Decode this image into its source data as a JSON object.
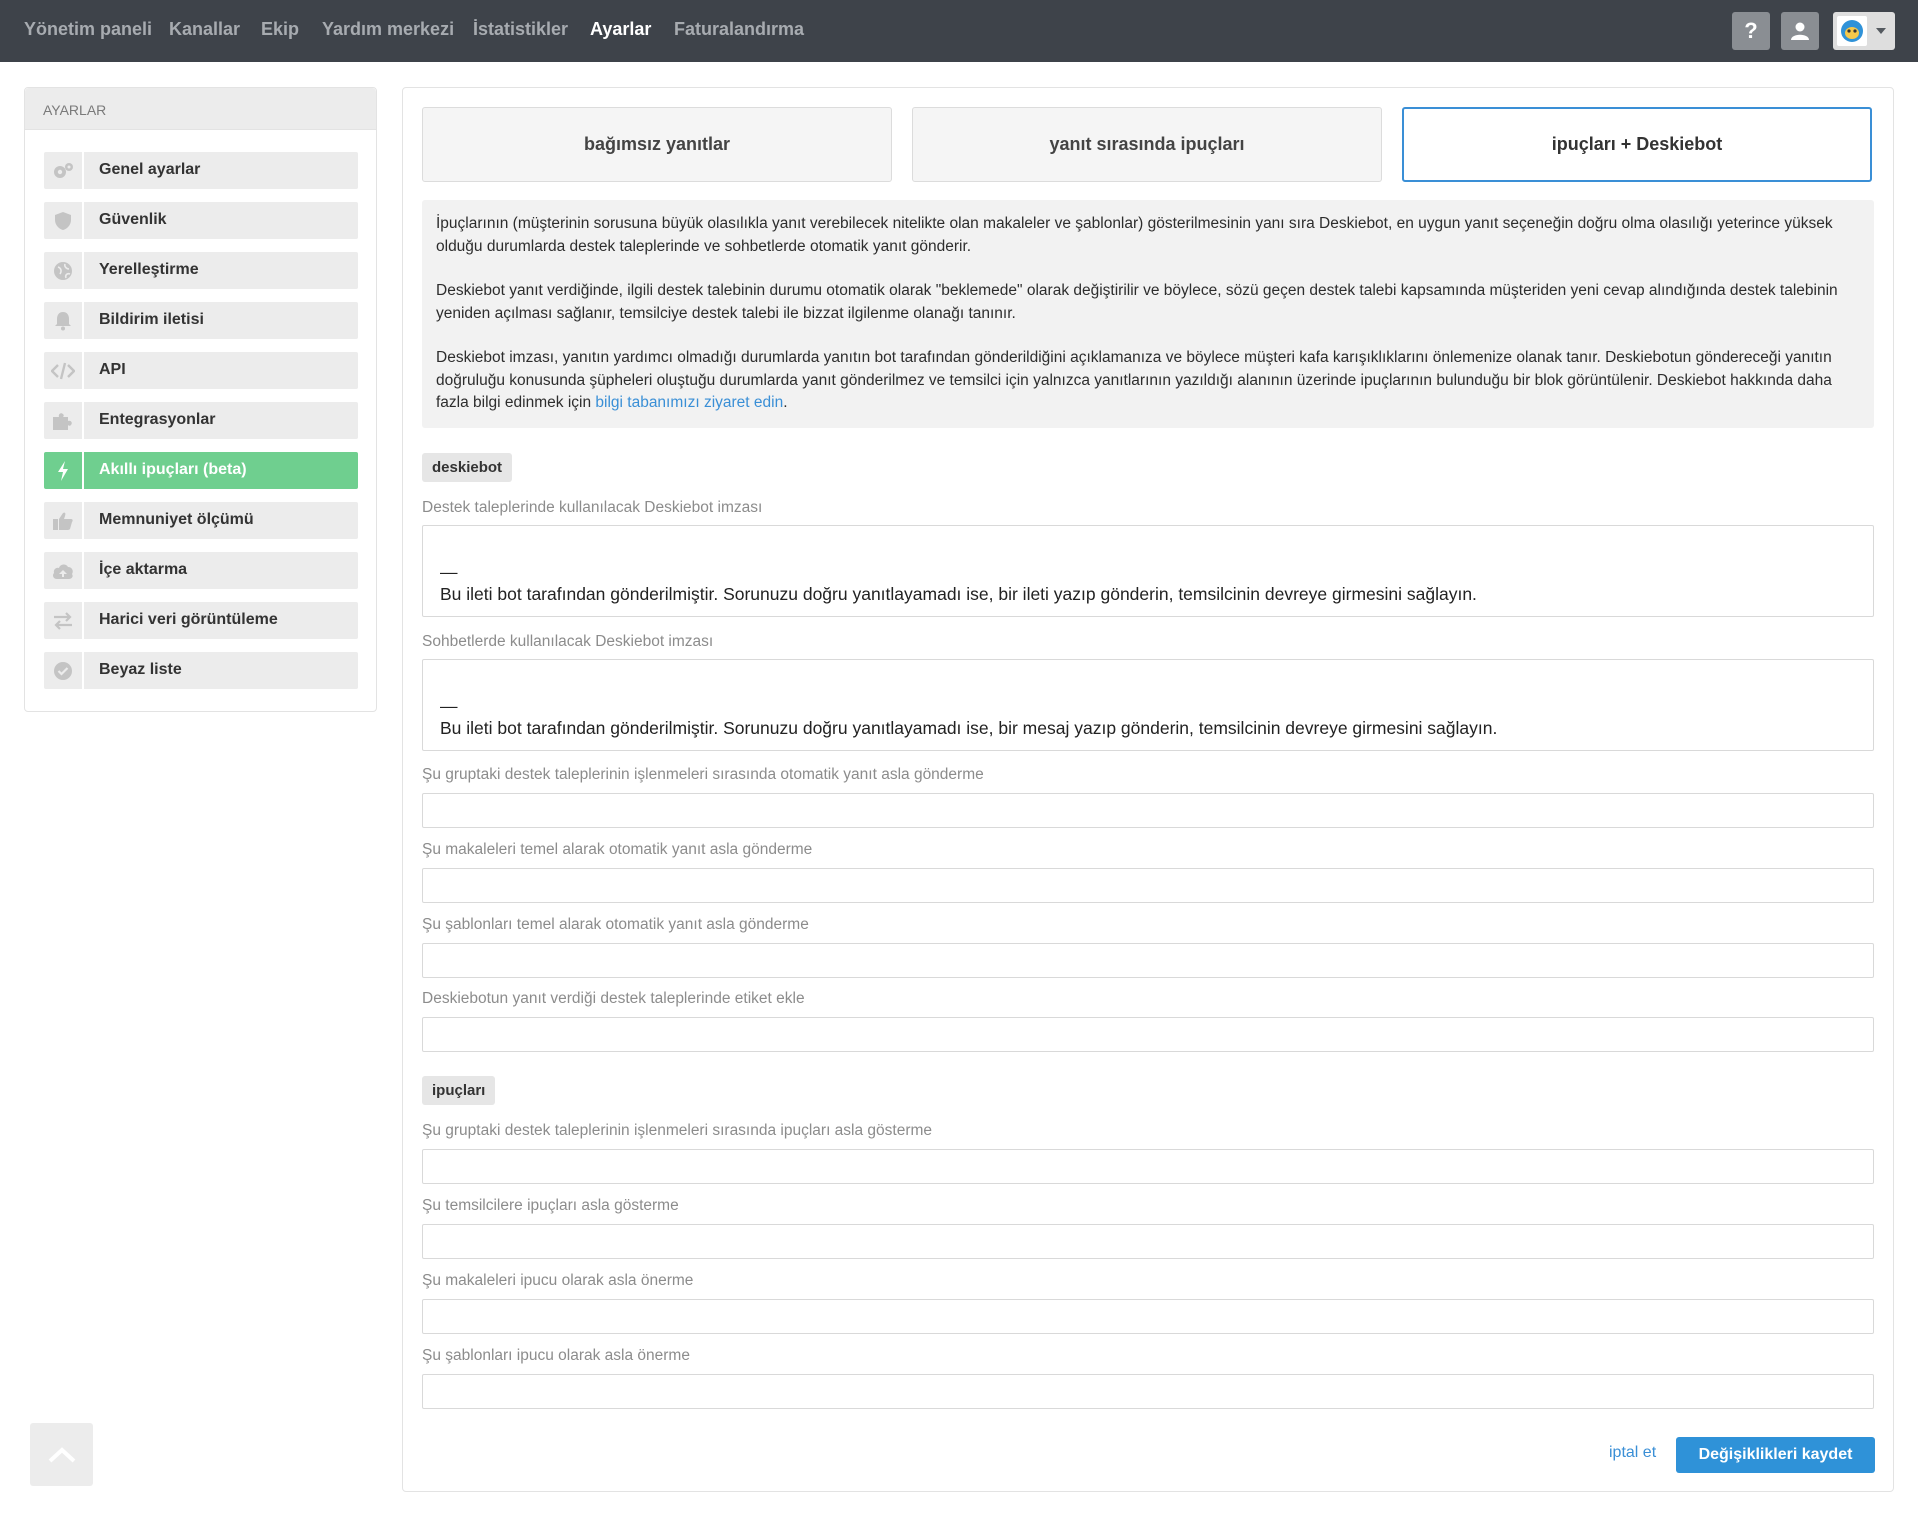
{
  "nav": {
    "items": [
      {
        "label": "Yönetim paneli"
      },
      {
        "label": "Kanallar"
      },
      {
        "label": "Ekip"
      },
      {
        "label": "Yardım merkezi"
      },
      {
        "label": "İstatistikler"
      },
      {
        "label": "Ayarlar",
        "active": true
      },
      {
        "label": "Faturalandırma"
      }
    ],
    "help_icon": "question-icon",
    "profile_icon": "user-icon",
    "avatar_icon": "avatar-icon"
  },
  "sidebar": {
    "title": "AYARLAR",
    "items": [
      {
        "label": "Genel ayarlar",
        "icon": "gears-icon"
      },
      {
        "label": "Güvenlik",
        "icon": "shield-icon"
      },
      {
        "label": "Yerelleştirme",
        "icon": "globe-icon"
      },
      {
        "label": "Bildirim iletisi",
        "icon": "bell-icon"
      },
      {
        "label": "API",
        "icon": "code-icon"
      },
      {
        "label": "Entegrasyonlar",
        "icon": "puzzle-icon"
      },
      {
        "label": "Akıllı ipuçları (beta)",
        "icon": "bolt-icon",
        "active": true
      },
      {
        "label": "Memnuniyet ölçümü",
        "icon": "thumbs-up-icon"
      },
      {
        "label": "İçe aktarma",
        "icon": "cloud-upload-icon"
      },
      {
        "label": "Harici veri görüntüleme",
        "icon": "exchange-icon"
      },
      {
        "label": "Beyaz liste",
        "icon": "check-badge-icon"
      }
    ]
  },
  "tabs": [
    {
      "label": "bağımsız yanıtlar"
    },
    {
      "label": "yanıt sırasında ipuçları"
    },
    {
      "label": "ipuçları + Deskiebot",
      "active": true
    }
  ],
  "info": {
    "p1": "İpuçlarının (müşterinin sorusuna büyük olasılıkla yanıt verebilecek nitelikte olan makaleler ve şablonlar) gösterilmesinin yanı sıra Deskiebot, en uygun yanıt seçeneğin doğru olma olasılığı yeterince yüksek olduğu durumlarda destek taleplerinde ve sohbetlerde otomatik yanıt gönderir.",
    "p2": "Deskiebot yanıt verdiğinde, ilgili destek talebinin durumu otomatik olarak \"beklemede\" olarak değiştirilir ve böylece, sözü geçen destek talebi kapsamında müşteriden yeni cevap alındığında destek talebinin yeniden açılması sağlanır, temsilciye destek talebi ile bizzat ilgilenme olanağı tanınır.",
    "p3": "Deskiebot imzası, yanıtın yardımcı olmadığı durumlarda yanıtın bot tarafından gönderildiğini açıklamanıza ve böylece müşteri kafa karışıklıklarını önlemenize olanak tanır. Deskiebotun göndereceği yanıtın doğruluğu konusunda şüpheleri oluştuğu durumlarda yanıt gönderilmez ve temsilci için yalnızca yanıtlarının yazıldığı alanının üzerinde ipuçlarının bulunduğu bir blok görüntülenir. Deskiebot hakkında daha fazla bilgi edinmek için",
    "link": "bilgi tabanımızı ziyaret edin",
    "p3_end": "."
  },
  "deskiebot": {
    "tag": "deskiebot",
    "ticket_sig_label": "Destek taleplerinde kullanılacak Deskiebot imzası",
    "ticket_sig_line1": "—",
    "ticket_sig_line2": "Bu ileti bot tarafından gönderilmiştir. Sorunuzu doğru yanıtlayamadı ise, bir ileti yazıp gönderin, temsilcinin devreye girmesini sağlayın.",
    "chat_sig_label": "Sohbetlerde kullanılacak Deskiebot imzası",
    "chat_sig_line1": "—",
    "chat_sig_line2": "Bu ileti bot tarafından gönderilmiştir. Sorunuzu doğru yanıtlayamadı ise, bir mesaj yazıp gönderin, temsilcinin devreye girmesini sağlayın.",
    "groups_label": "Şu gruptaki destek taleplerinin işlenmeleri sırasında otomatik yanıt asla gönderme",
    "articles_label": "Şu makaleleri temel alarak otomatik yanıt asla gönderme",
    "templates_label": "Şu şablonları temel alarak otomatik yanıt asla gönderme",
    "tags_label": "Deskiebotun yanıt verdiği destek taleplerinde etiket ekle"
  },
  "hints": {
    "tag": "ipuçları",
    "groups_label": "Şu gruptaki destek taleplerinin işlenmeleri sırasında ipuçları asla gösterme",
    "agents_label": "Şu temsilcilere ipuçları asla gösterme",
    "articles_label": "Şu makaleleri ipucu olarak asla önerme",
    "templates_label": "Şu şablonları ipucu olarak asla önerme"
  },
  "actions": {
    "cancel": "iptal et",
    "save": "Değişiklikleri kaydet"
  },
  "scroll_top_icon": "chevron-up-icon",
  "colors": {
    "topbar": "#3e434a",
    "accent": "#2f92d8",
    "active_sidebar": "#6fcf8f"
  }
}
